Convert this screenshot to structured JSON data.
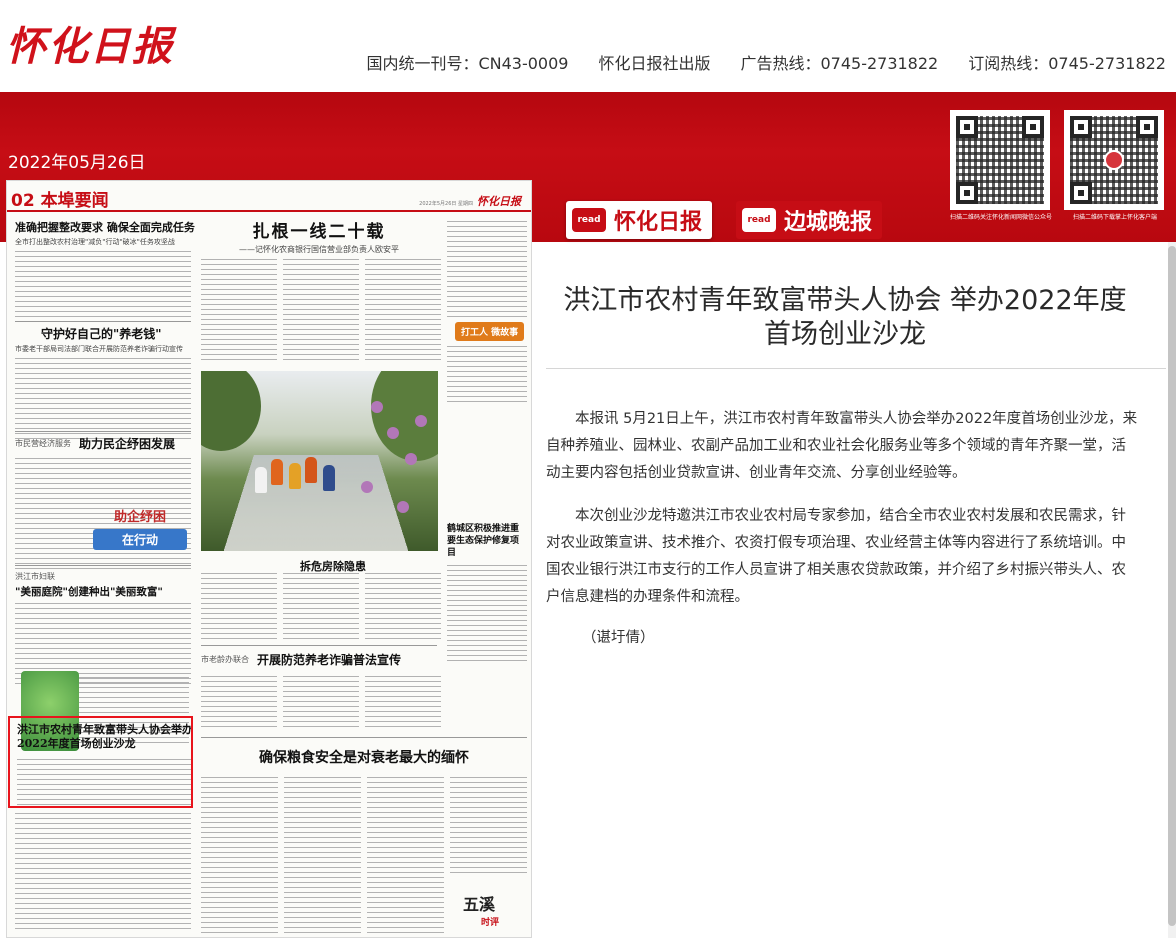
{
  "header": {
    "logo": "怀化日报",
    "info": [
      "国内统一刊号：CN43-0009",
      "怀化日报社出版",
      "广告热线：0745-2731822",
      "订阅热线：0745-2731822"
    ]
  },
  "edition_date": "2022年05月26日",
  "qr_codes": [
    {
      "caption": "扫描二维码关注怀化新闻网微信公众号"
    },
    {
      "caption": "扫描二维码下载掌上怀化客户端"
    }
  ],
  "tabs": [
    {
      "badge": "read",
      "label": "怀化日报"
    },
    {
      "badge": "read",
      "label": "边城晚报"
    }
  ],
  "newspaper": {
    "page_label": "02 本埠要闻",
    "masthead": "怀化日报",
    "masthead_note": "2022年5月26日 星期四",
    "headlines": {
      "left_1": "准确把握整改要求  确保全面完成任务",
      "left_1_sub": "全市打出整改农村治理\"减负\"行动\"破冰\"任务攻坚战",
      "left_2": "守护好自己的\"养老钱\"",
      "left_2_sub": "市委老干部局司法部门联合开展防范养老诈骗行动宣传",
      "left_3": "助力民企纾困发展",
      "left_3_kicker": "市民营经济服务",
      "left_4": "\"美丽庭院\"创建种出\"美丽致富\"",
      "left_4_kicker": "洪江市妇联",
      "center_main": "扎根一线二十载",
      "center_main_sub": "——记怀化农商银行国信营业部负责人欧安平",
      "photo_caption": "拆危房除隐患",
      "center_2": "开展防范养老诈骗普法宣传",
      "center_2_kicker": "市老龄办联合",
      "center_3": "确保粮食安全是对衰老最大的缅怀",
      "right_1": "鹤城区积极推进重要生态保护修复项目",
      "highlighted_title": "洪江市农村青年致富带头人协会举办2022年度首场创业沙龙",
      "stamp": "打工人 微故事",
      "banner": "助企纾困",
      "banner_sub": "在行动",
      "signature": "五溪",
      "signature_sub": "时评"
    }
  },
  "article": {
    "title": "洪江市农村青年致富带头人协会 举办2022年度首场创业沙龙",
    "paragraphs": [
      "本报讯 5月21日上午，洪江市农村青年致富带头人协会举办2022年度首场创业沙龙，来自种养殖业、园林业、农副产品加工业和农业社会化服务业等多个领域的青年齐聚一堂，活动主要内容包括创业贷款宣讲、创业青年交流、分享创业经验等。",
      "本次创业沙龙特邀洪江市农业农村局专家参加，结合全市农业农村发展和农民需求，针对农业政策宣讲、技术推介、农资打假专项治理、农业经营主体等内容进行了系统培训。中国农业银行洪江市支行的工作人员宣讲了相关惠农贷款政策，并介绍了乡村振兴带头人、农户信息建档的办理条件和流程。"
    ],
    "author": "（谌圩倩）"
  },
  "colors": {
    "brand_red": "#c60d15",
    "highlight_red": "#e8141c"
  }
}
